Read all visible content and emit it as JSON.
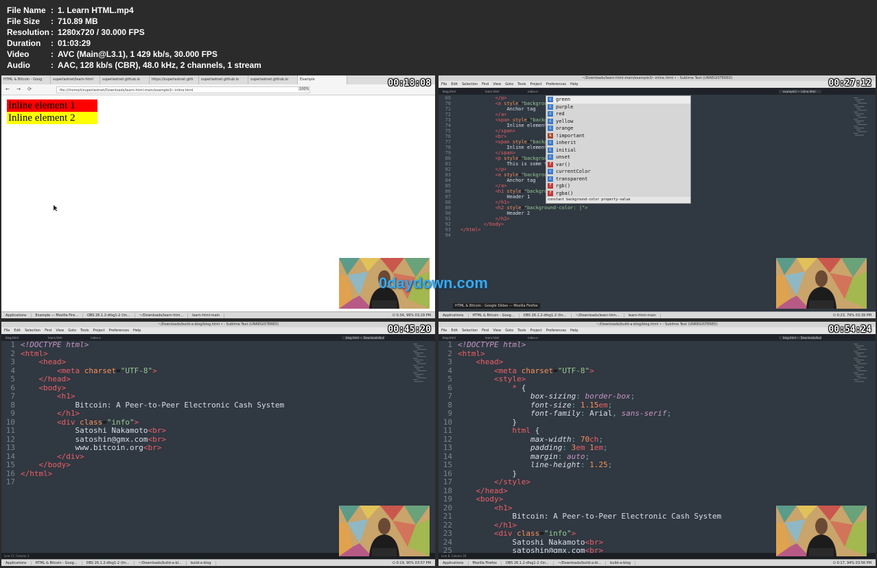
{
  "file_info": [
    {
      "key": "File Name",
      "value": "1. Learn HTML.mp4"
    },
    {
      "key": "File Size",
      "value": "710.89 MB"
    },
    {
      "key": "Resolution",
      "value": "1280x720 / 30.000 FPS"
    },
    {
      "key": "Duration",
      "value": "01:03:29"
    },
    {
      "key": "Video",
      "value": "AVC (Main@L3.1), 1 429 kb/s, 30.000 FPS"
    },
    {
      "key": "Audio",
      "value": "AAC, 128 kb/s (CBR), 48.0 kHz, 2 channels, 1 stream"
    }
  ],
  "separator": ":",
  "watermark": "0daydown.com",
  "thumbs": {
    "t1": {
      "timestamp": "00:18:08",
      "tabs": [
        "HTML & Bitcoin - Goog",
        "superlastnet/learn-html",
        "superlastnet.github.io",
        "https://superlastnet.gith",
        "superlastnet.github.io",
        "superlastnet.github.io",
        "Example"
      ],
      "nav_buttons": "← → ⟳",
      "url": "file:///home/t/superlastnet/Downloads/learn-html-main/example3/--inline.html",
      "zoom": "100%",
      "inline1": "Inline element 1",
      "inline2": "Inline element 2",
      "taskbar": [
        "Applications",
        "Example — Mozilla Fire...",
        "OBS 26.1.2-dfsg1-2 (lin...",
        "~/Downloads/learn-htm...",
        "learn-html-main"
      ],
      "tray": "⏻ 0:34, 99%  03:29 PM"
    },
    "t2": {
      "timestamp": "00:27:12",
      "title": "~/Downloads/learn-html-main/example3/--inline.html • - Sublime Text (UNREGISTERED)",
      "menu": [
        "File",
        "Edit",
        "Selection",
        "Find",
        "View",
        "Goto",
        "Tools",
        "Project",
        "Preferences",
        "Help"
      ],
      "tabs": [
        "blog.html",
        "learn.html",
        "index.e",
        "",
        "",
        "",
        "",
        "",
        "example3 — inline.html"
      ],
      "lines": [
        {
          "n": "69",
          "html": "            <span class=\"k\">&lt;/p&gt;</span>"
        },
        {
          "n": "70",
          "html": "            <span class=\"k\">&lt;a</span> <span class=\"a\">style</span>=<span class=\"s\">\"background-colo</span>"
        },
        {
          "n": "71",
          "html": "                <span class=\"t\">Anchor tag</span>"
        },
        {
          "n": "72",
          "html": "            <span class=\"k\">&lt;/a&gt;</span>"
        },
        {
          "n": "73",
          "html": "            <span class=\"k\">&lt;span</span> <span class=\"a\">style</span>=<span class=\"s\">\"background-co</span>"
        },
        {
          "n": "74",
          "html": "                <span class=\"t\">Inline element 1</span>"
        },
        {
          "n": "75",
          "html": "            <span class=\"k\">&lt;/span&gt;</span>"
        },
        {
          "n": "76",
          "html": "            <span class=\"k\">&lt;br&gt;</span>"
        },
        {
          "n": "77",
          "html": "            <span class=\"k\">&lt;span</span> <span class=\"a\">style</span>=<span class=\"s\">\"background-co</span>"
        },
        {
          "n": "78",
          "html": "                <span class=\"t\">Inline element 2</span>"
        },
        {
          "n": "79",
          "html": "            <span class=\"k\">&lt;/span&gt;</span>"
        },
        {
          "n": "80",
          "html": "            <span class=\"k\">&lt;p</span> <span class=\"a\">style</span>=<span class=\"s\">\"background-colo</span>"
        },
        {
          "n": "81",
          "html": "                <span class=\"t\">This is some text</span>"
        },
        {
          "n": "82",
          "html": "            <span class=\"k\">&lt;/p&gt;</span>"
        },
        {
          "n": "83",
          "html": "            <span class=\"k\">&lt;a</span> <span class=\"a\">style</span>=<span class=\"s\">\"background-colo</span>"
        },
        {
          "n": "84",
          "html": "                <span class=\"t\">Anchor tag</span>"
        },
        {
          "n": "85",
          "html": "            <span class=\"k\">&lt;/a&gt;</span>"
        },
        {
          "n": "86",
          "html": "            <span class=\"k\">&lt;h1</span> <span class=\"a\">style</span>=<span class=\"s\">\"background-colo</span>"
        },
        {
          "n": "87",
          "html": "                <span class=\"t\">Header 1</span>"
        },
        {
          "n": "88",
          "html": "            <span class=\"k\">&lt;/h1&gt;</span>"
        },
        {
          "n": "89",
          "html": "            <span class=\"k\">&lt;h2</span> <span class=\"a\">style</span>=<span class=\"s\">\"background-color: |\"&gt;</span>"
        },
        {
          "n": "90",
          "html": "                <span class=\"t\">Header 2</span>"
        },
        {
          "n": "91",
          "html": "            <span class=\"k\">&lt;/h2&gt;</span>"
        },
        {
          "n": "92",
          "html": "        <span class=\"k\">&lt;/body&gt;</span>"
        },
        {
          "n": "93",
          "html": "<span class=\"k\">&lt;/html&gt;</span>"
        },
        {
          "n": "94",
          "html": ""
        }
      ],
      "autocomplete": [
        {
          "kind": "c",
          "label": "green"
        },
        {
          "kind": "c",
          "label": "purple"
        },
        {
          "kind": "c",
          "label": "red"
        },
        {
          "kind": "c",
          "label": "yellow"
        },
        {
          "kind": "c",
          "label": "orange"
        },
        {
          "kind": "k",
          "label": "!important"
        },
        {
          "kind": "c",
          "label": "inherit"
        },
        {
          "kind": "c",
          "label": "initial"
        },
        {
          "kind": "c",
          "label": "unset"
        },
        {
          "kind": "f",
          "label": "var()"
        },
        {
          "kind": "c",
          "label": "currentColor"
        },
        {
          "kind": "c",
          "label": "transparent"
        },
        {
          "kind": "f",
          "label": "rgb()"
        },
        {
          "kind": "f",
          "label": "rgba()"
        }
      ],
      "ac_footer": "constant background-color property-value",
      "tooltip": "HTML & Bitcoin - Google Slides — Mozilla Firefox",
      "taskbar": [
        "Applications",
        "HTML & Bitcoin - Goog...",
        "OBS 26.1.2-dfsg1-2 (lin...",
        "~/Downloads/learn-htm...",
        "learn-html-main"
      ],
      "tray": "⏻ 0:23, 79%  03:39 PM"
    },
    "t3": {
      "timestamp": "00:45:20",
      "title": "~/Downloads/build-a-blog/blog.html • - Sublime Text (UNREGISTERED)",
      "menu": [
        "File",
        "Edit",
        "Selection",
        "Find",
        "View",
        "Goto",
        "Tools",
        "Project",
        "Preferences",
        "Help"
      ],
      "tabs": [
        "blog.html",
        "learn.html",
        "index.e",
        "",
        "",
        "",
        "",
        "",
        "blog.html — Downloads/build-a-blog"
      ],
      "lines": [
        {
          "n": "1",
          "html": "<span class=\"c\">&lt;!DOCTYPE html&gt;</span>"
        },
        {
          "n": "2",
          "html": "<span class=\"k\">&lt;html&gt;</span>"
        },
        {
          "n": "3",
          "html": "    <span class=\"k\">&lt;head&gt;</span>"
        },
        {
          "n": "4",
          "html": "        <span class=\"k\">&lt;meta</span> <span class=\"a\">charset</span>=<span class=\"s\">\"UTF-8\"</span><span class=\"k\">&gt;</span>"
        },
        {
          "n": "5",
          "html": "    <span class=\"k\">&lt;/head&gt;</span>"
        },
        {
          "n": "6",
          "html": "    <span class=\"k\">&lt;body&gt;</span>"
        },
        {
          "n": "7",
          "html": "        <span class=\"k\">&lt;h1&gt;</span>"
        },
        {
          "n": "8",
          "html": "            <span class=\"t\">Bitcoin: A Peer-to-Peer Electronic Cash System</span>"
        },
        {
          "n": "9",
          "html": "        <span class=\"k\">&lt;/h1&gt;</span>"
        },
        {
          "n": "10",
          "html": "        <span class=\"k\">&lt;div</span> <span class=\"a\">class</span>=<span class=\"s\">\"info\"</span><span class=\"k\">&gt;</span>"
        },
        {
          "n": "11",
          "html": "            <span class=\"t\">Satoshi Nakamoto</span><span class=\"k\">&lt;br&gt;</span>"
        },
        {
          "n": "12",
          "html": "            <span class=\"t\">satoshin@gmx.com</span><span class=\"k\">&lt;br&gt;</span>"
        },
        {
          "n": "13",
          "html": "            <span class=\"t\">www.bitcoin.org</span><span class=\"k\">&lt;br&gt;</span>"
        },
        {
          "n": "14",
          "html": "        <span class=\"k\">&lt;/div&gt;</span>"
        },
        {
          "n": "15",
          "html": "    <span class=\"k\">&lt;/body&gt;</span>"
        },
        {
          "n": "16",
          "html": "<span class=\"k\">&lt;/html&gt;</span>"
        },
        {
          "n": "17",
          "html": ""
        }
      ],
      "status": "Line 17, Column 1",
      "taskbar": [
        "Applications",
        "HTML & Bitcoin - Goog...",
        "OBS 26.1.2-dfsg1-2 (lin...",
        "~/Downloads/build-a-bl...",
        "build-a-blog"
      ],
      "tray": "⏻ 0:19, 90%  03:57 PM"
    },
    "t4": {
      "timestamp": "00:54:24",
      "title": "~/Downloads/build-a-blog/blog.html • - Sublime Text (UNREGISTERED)",
      "menu": [
        "File",
        "Edit",
        "Selection",
        "Find",
        "View",
        "Goto",
        "Tools",
        "Project",
        "Preferences",
        "Help"
      ],
      "tabs": [
        "blog.html",
        "learn.html",
        "index.e",
        "",
        "",
        "",
        "",
        "",
        "blog.html — Downloads/build-a-blog"
      ],
      "lines": [
        {
          "n": "1",
          "html": "<span class=\"c\">&lt;!DOCTYPE html&gt;</span>"
        },
        {
          "n": "2",
          "html": "<span class=\"k\">&lt;html&gt;</span>"
        },
        {
          "n": "3",
          "html": "    <span class=\"k\">&lt;head&gt;</span>"
        },
        {
          "n": "4",
          "html": "        <span class=\"k\">&lt;meta</span> <span class=\"a\">charset</span>=<span class=\"s\">\"UTF-8\"</span><span class=\"k\">&gt;</span>"
        },
        {
          "n": "5",
          "html": "        <span class=\"k\">&lt;style&gt;</span>"
        },
        {
          "n": "6",
          "html": "            <span class=\"k\">*</span> <span class=\"t\">{</span>"
        },
        {
          "n": "7",
          "html": "                <span class=\"prop\">box-sizing</span><span class=\"pun\">:</span> <span class=\"val\">border-box</span><span class=\"pun\">;</span>"
        },
        {
          "n": "8",
          "html": "                <span class=\"prop\">font-size</span><span class=\"pun\">:</span> <span class=\"num\">1.15</span><span class=\"k\">em</span><span class=\"pun\">;</span>"
        },
        {
          "n": "9",
          "html": "                <span class=\"prop\">font-family</span><span class=\"pun\">:</span> <span class=\"t\">Arial</span><span class=\"pun\">,</span> <span class=\"val\">sans-serif</span><span class=\"pun\">;</span>"
        },
        {
          "n": "10",
          "html": "            <span class=\"t\">}</span>"
        },
        {
          "n": "11",
          "html": "            <span class=\"k\">html</span> <span class=\"t\">{</span>"
        },
        {
          "n": "12",
          "html": "                <span class=\"prop\">max-width</span><span class=\"pun\">:</span> <span class=\"num\">70</span><span class=\"k\">ch</span><span class=\"pun\">;</span>"
        },
        {
          "n": "13",
          "html": "                <span class=\"prop\">padding</span><span class=\"pun\">:</span> <span class=\"num\">3</span><span class=\"k\">em</span> <span class=\"num\">1</span><span class=\"k\">em</span><span class=\"pun\">;</span>"
        },
        {
          "n": "14",
          "html": "                <span class=\"prop\">margin</span><span class=\"pun\">:</span> <span class=\"val\">auto</span><span class=\"pun\">;</span>"
        },
        {
          "n": "15",
          "html": "                <span class=\"prop\">line-height</span><span class=\"pun\">:</span> <span class=\"num\">1.25</span><span class=\"pun\">;</span>"
        },
        {
          "n": "16",
          "html": "            <span class=\"t\">}</span>"
        },
        {
          "n": "17",
          "html": "        <span class=\"k\">&lt;/style&gt;</span>"
        },
        {
          "n": "18",
          "html": "    <span class=\"k\">&lt;/head&gt;</span>"
        },
        {
          "n": "19",
          "html": "    <span class=\"k\">&lt;body&gt;</span>"
        },
        {
          "n": "20",
          "html": "        <span class=\"k\">&lt;h1&gt;</span>"
        },
        {
          "n": "21",
          "html": "            <span class=\"t\">Bitcoin: A Peer-to-Peer Electronic Cash System</span>"
        },
        {
          "n": "22",
          "html": "        <span class=\"k\">&lt;/h1&gt;</span>"
        },
        {
          "n": "23",
          "html": "        <span class=\"k\">&lt;div</span> <span class=\"a\">class</span>=<span class=\"s\">\"info\"</span><span class=\"k\">&gt;</span>"
        },
        {
          "n": "24",
          "html": "            <span class=\"t\">Satoshi Nakamoto</span><span class=\"k\">&lt;br&gt;</span>"
        },
        {
          "n": "25",
          "html": "            <span class=\"t\">satoshin@gmx.com</span><span class=\"k\">&lt;br&gt;</span>"
        }
      ],
      "status": "Line 8, Column 20",
      "taskbar": [
        "Applications",
        "Mozilla Firefox",
        "OBS 26.1.2-dfsg1-2 (lin...",
        "~/Downloads/build-a-bl...",
        "build-a-blog"
      ],
      "tray": "⏻ 0:17, 94%  03:56 PM"
    }
  },
  "colors": {
    "inline1_bg": "#ff0000",
    "inline2_bg": "#ffff00",
    "editor_bg": "#303841",
    "accent_watermark": "#3ba7e8"
  }
}
